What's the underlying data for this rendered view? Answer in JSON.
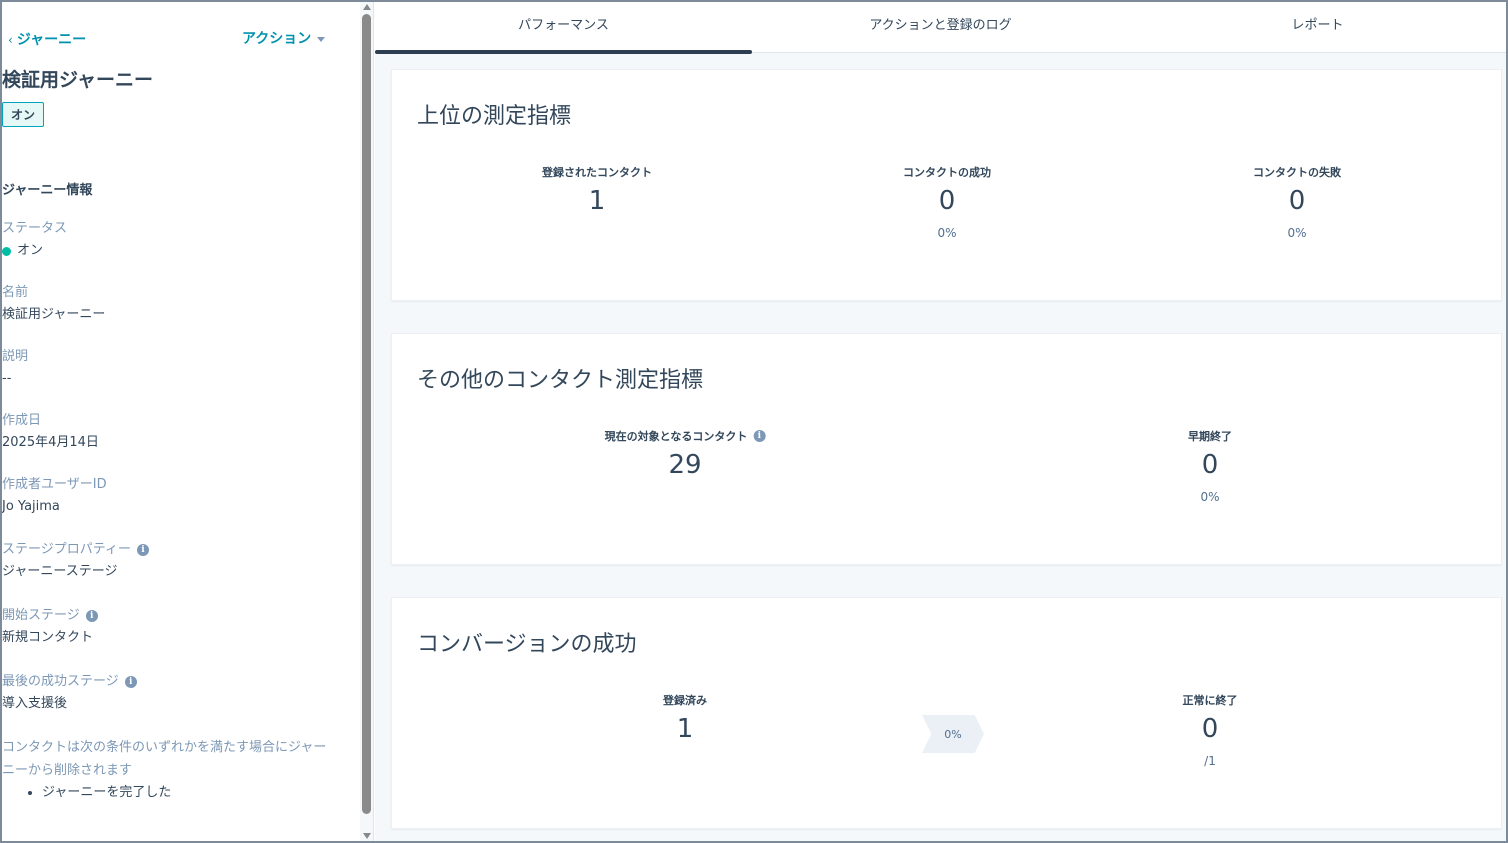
{
  "sidebar": {
    "back_label": "ジャーニー",
    "actions_label": "アクション",
    "title": "検証用ジャーニー",
    "status_tag": "オン",
    "section_title": "ジャーニー情報",
    "props": {
      "status": {
        "label": "ステータス",
        "value": "オン"
      },
      "name": {
        "label": "名前",
        "value": "検証用ジャーニー"
      },
      "description": {
        "label": "説明",
        "value": "--"
      },
      "created": {
        "label": "作成日",
        "value": "2025年4月14日"
      },
      "creator": {
        "label": "作成者ユーザーID",
        "value": "Jo Yajima"
      },
      "stage_property": {
        "label": "ステージプロパティー",
        "value": "ジャーニーステージ"
      },
      "start_stage": {
        "label": "開始ステージ",
        "value": "新規コンタクト"
      },
      "last_success_stage": {
        "label": "最後の成功ステージ",
        "value": "導入支援後"
      }
    },
    "removal_text": "コンタクトは次の条件のいずれかを満たす場合にジャーニーから削除されます",
    "removal_items": [
      "ジャーニーを完了した"
    ]
  },
  "tabs": [
    {
      "label": "パフォーマンス",
      "active": true
    },
    {
      "label": "アクションと登録のログ",
      "active": false
    },
    {
      "label": "レポート",
      "active": false
    }
  ],
  "top_metrics": {
    "title": "上位の測定指標",
    "enrolled": {
      "label": "登録されたコンタクト",
      "value": "1"
    },
    "succeeded": {
      "label": "コンタクトの成功",
      "value": "0",
      "pct": "0%"
    },
    "failed": {
      "label": "コンタクトの失敗",
      "value": "0",
      "pct": "0%"
    }
  },
  "other_metrics": {
    "title": "その他のコンタクト測定指標",
    "current": {
      "label": "現在の対象となるコンタクト",
      "value": "29"
    },
    "early_exit": {
      "label": "早期終了",
      "value": "0",
      "pct": "0%"
    }
  },
  "conversion": {
    "title": "コンバージョンの成功",
    "enrolled": {
      "label": "登録済み",
      "value": "1"
    },
    "rate": "0%",
    "completed": {
      "label": "正常に終了",
      "value": "0",
      "sub": "/1"
    }
  },
  "colors": {
    "link": "#0091ae",
    "status_green": "#00bda5",
    "text": "#33475b",
    "label": "#7c98b6",
    "tab_active": "#2d3e50"
  }
}
